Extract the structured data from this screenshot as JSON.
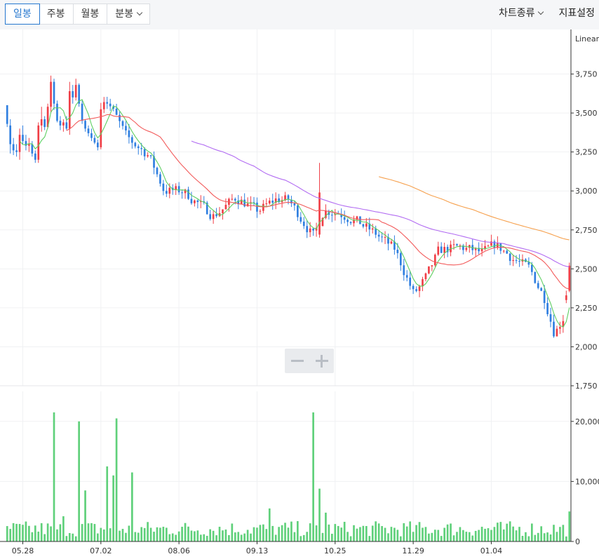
{
  "toolbar": {
    "periods": [
      "일봉",
      "주봉",
      "월봉",
      "분봉"
    ],
    "active_period": "일봉",
    "chart_type_label": "차트종류",
    "indicator_settings_label": "지표설정"
  },
  "chart_data": {
    "type": "candlestick",
    "scale_label": "Linear",
    "price_axis": {
      "ticks": [
        1750,
        2000,
        2250,
        2500,
        2750,
        3000,
        3250,
        3500,
        3750
      ],
      "tick_labels": [
        "1,750",
        "2,000",
        "2,250",
        "2,500",
        "2,750",
        "3,000",
        "3,250",
        "3,500",
        "3,750"
      ],
      "range": [
        1750,
        4000
      ]
    },
    "volume_axis": {
      "ticks": [
        0,
        10000000,
        20000000
      ],
      "tick_labels": [
        "0",
        "10,000,",
        "20,000,"
      ],
      "range": [
        0,
        25000000
      ]
    },
    "x_tick_labels": [
      "05.28",
      "07.02",
      "08.06",
      "09.13",
      "10.25",
      "11.29",
      "01.04"
    ],
    "x_tick_bar_index": [
      5,
      30,
      55,
      80,
      105,
      130,
      155
    ],
    "up_color": "#f03e46",
    "down_color": "#2f7fe0",
    "volume_color": "#5fd07a",
    "ma_colors": [
      "#5fcf61",
      "#f25a5a",
      "#b26cf2",
      "#f6a04d"
    ],
    "candles_start": [
      [
        3550,
        3550,
        3410,
        3430
      ],
      [
        3420,
        3460,
        3240,
        3300
      ],
      [
        3300,
        3340,
        3230,
        3260
      ],
      [
        3260,
        3300,
        3220,
        3250
      ],
      [
        3250,
        3400,
        3200,
        3360
      ],
      [
        3360,
        3420,
        3300,
        3320
      ],
      [
        3320,
        3360,
        3260,
        3290
      ],
      [
        3290,
        3340,
        3250,
        3300
      ],
      [
        3300,
        3320,
        3220,
        3240
      ],
      [
        3240,
        3260,
        3180,
        3200
      ],
      [
        3200,
        3440,
        3180,
        3420
      ],
      [
        3420,
        3540,
        3380,
        3460
      ],
      [
        3460,
        3480,
        3390,
        3410
      ],
      [
        3410,
        3560,
        3400,
        3540
      ],
      [
        3540,
        3740,
        3500,
        3700
      ],
      [
        3700,
        3720,
        3520,
        3560
      ],
      [
        3560,
        3580,
        3440,
        3450
      ],
      [
        3450,
        3480,
        3390,
        3420
      ],
      [
        3420,
        3460,
        3380,
        3440
      ],
      [
        3440,
        3480,
        3390,
        3400
      ],
      [
        3400,
        3700,
        3360,
        3640
      ],
      [
        3640,
        3680,
        3560,
        3600
      ],
      [
        3600,
        3720,
        3580,
        3680
      ],
      [
        3680,
        3690,
        3540,
        3560
      ],
      [
        3560,
        3580,
        3430,
        3450
      ],
      [
        3450,
        3460,
        3380,
        3400
      ],
      [
        3400,
        3420,
        3350,
        3370
      ],
      [
        3370,
        3400,
        3320,
        3340
      ],
      [
        3340,
        3360,
        3300,
        3310
      ],
      [
        3310,
        3330,
        3260,
        3280
      ]
    ],
    "volumes_sample": [
      2500000,
      3200000,
      1800000,
      21500000,
      4200000,
      3900000,
      20000000,
      8500000,
      20500000,
      11500000,
      21500000,
      8800000,
      4800000,
      1200000
    ]
  }
}
